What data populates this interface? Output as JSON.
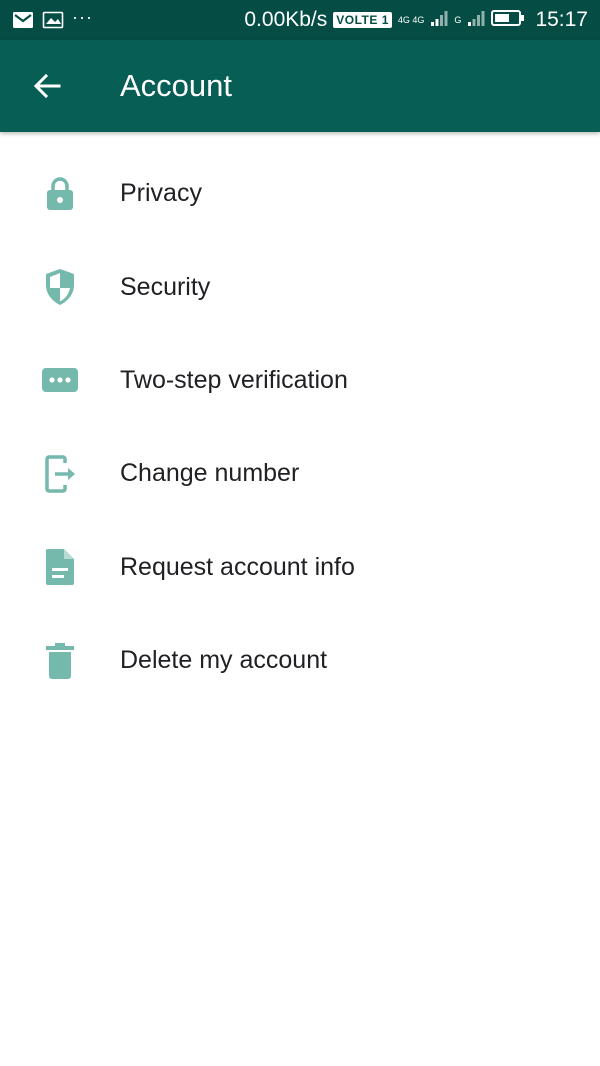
{
  "status_bar": {
    "speed": "0.00Kb/s",
    "volte": "VOLTE 1",
    "net1": "4G 4G",
    "net2": "G",
    "time": "15:17"
  },
  "app_bar": {
    "title": "Account"
  },
  "menu": [
    {
      "label": "Privacy",
      "icon": "lock-icon"
    },
    {
      "label": "Security",
      "icon": "shield-icon"
    },
    {
      "label": "Two-step verification",
      "icon": "dots-icon"
    },
    {
      "label": "Change number",
      "icon": "phone-change-icon"
    },
    {
      "label": "Request account info",
      "icon": "document-icon"
    },
    {
      "label": "Delete my account",
      "icon": "trash-icon"
    }
  ],
  "colors": {
    "status_bar": "#054d44",
    "app_bar": "#075e54",
    "icon": "#74b9ac"
  }
}
